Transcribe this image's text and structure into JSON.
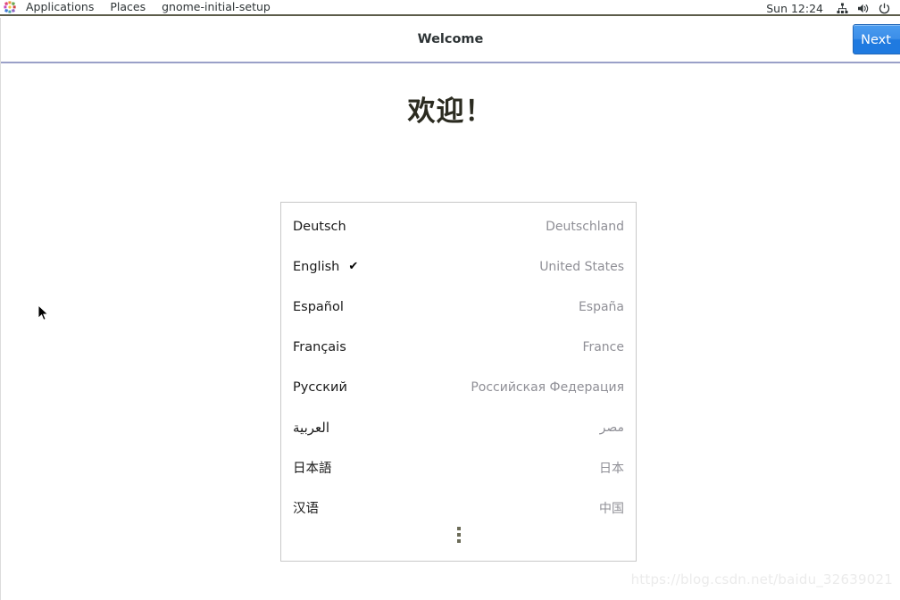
{
  "top_panel": {
    "apps_icon": "applications-pinwheel-icon",
    "applications_label": "Applications",
    "places_label": "Places",
    "window_name": "gnome-initial-setup",
    "clock": "Sun 12:24",
    "tray": [
      {
        "icon": "network-wired-icon"
      },
      {
        "icon": "volume-icon"
      },
      {
        "icon": "power-icon"
      }
    ]
  },
  "window": {
    "title": "Welcome",
    "next_label": "Next"
  },
  "content": {
    "heading": "欢迎！",
    "more_button_icon": "more-vertical-icon"
  },
  "languages": [
    {
      "name": "Deutsch",
      "country": "Deutschland",
      "selected": false,
      "rtl": false
    },
    {
      "name": "English",
      "country": "United States",
      "selected": true,
      "rtl": false
    },
    {
      "name": "Español",
      "country": "España",
      "selected": false,
      "rtl": false
    },
    {
      "name": "Français",
      "country": "France",
      "selected": false,
      "rtl": false
    },
    {
      "name": "Русский",
      "country": "Российская Федерация",
      "selected": false,
      "rtl": false
    },
    {
      "name": "العربية",
      "country": "مصر",
      "selected": false,
      "rtl": true
    },
    {
      "name": "日本語",
      "country": "日本",
      "selected": false,
      "rtl": false
    },
    {
      "name": "汉语",
      "country": "中国",
      "selected": false,
      "rtl": false
    }
  ],
  "check_glyph": "✔",
  "watermark": "https://blog.csdn.net/baidu_32639021",
  "colors": {
    "accent_blue": "#2a87e8",
    "panel_border": "#5c5c4a",
    "header_underline": "#9aa0c8",
    "country_text": "#8f8f96",
    "watermark_text": "#ebebeb"
  }
}
